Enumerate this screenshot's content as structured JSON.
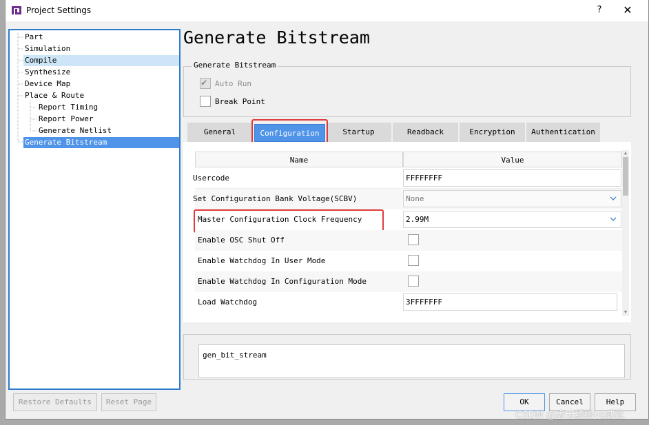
{
  "window": {
    "title": "Project Settings",
    "help_label": "?",
    "close_label": "✕"
  },
  "tree": {
    "items": [
      {
        "label": "Part"
      },
      {
        "label": "Simulation"
      },
      {
        "label": "Compile"
      },
      {
        "label": "Synthesize"
      },
      {
        "label": "Device Map"
      },
      {
        "label": "Place & Route"
      },
      {
        "label": "Report Timing"
      },
      {
        "label": "Report Power"
      },
      {
        "label": "Generate Netlist"
      },
      {
        "label": "Generate Bitstream"
      }
    ]
  },
  "page": {
    "title": "Generate Bitstream",
    "group_title": "Generate Bitstream",
    "auto_run": {
      "label": "Auto Run",
      "checked": true,
      "enabled": false
    },
    "break_point": {
      "label": "Break Point",
      "checked": false,
      "enabled": true
    }
  },
  "tabs": [
    {
      "label": "General"
    },
    {
      "label": "Configuration"
    },
    {
      "label": "Startup"
    },
    {
      "label": "Readback"
    },
    {
      "label": "Encryption"
    },
    {
      "label": "Authentication"
    }
  ],
  "table": {
    "col_name": "Name",
    "col_value": "Value",
    "rows": [
      {
        "name": "Usercode",
        "value": "FFFFFFFF"
      },
      {
        "name": "Set Configuration Bank Voltage(SCBV)",
        "value": "None"
      },
      {
        "name": "Master Configuration Clock Frequency",
        "value": "2.99M"
      },
      {
        "name": "Enable OSC Shut Off",
        "value": ""
      },
      {
        "name": "Enable Watchdog In User Mode",
        "value": ""
      },
      {
        "name": "Enable Watchdog In Configuration Mode",
        "value": ""
      },
      {
        "name": "Load Watchdog",
        "value": "3FFFFFFF"
      }
    ]
  },
  "console": {
    "text": "gen_bit_stream"
  },
  "buttons": {
    "restore_defaults": "Restore Defaults",
    "reset_page": "Reset Page",
    "ok": "OK",
    "cancel": "Cancel",
    "help": "Help"
  },
  "watermark": "CSDN @虚无缥缈vs威武",
  "colors": {
    "accent": "#4f94e8",
    "highlight_light": "#cde6f7",
    "annotation_red": "#e03b3b"
  }
}
